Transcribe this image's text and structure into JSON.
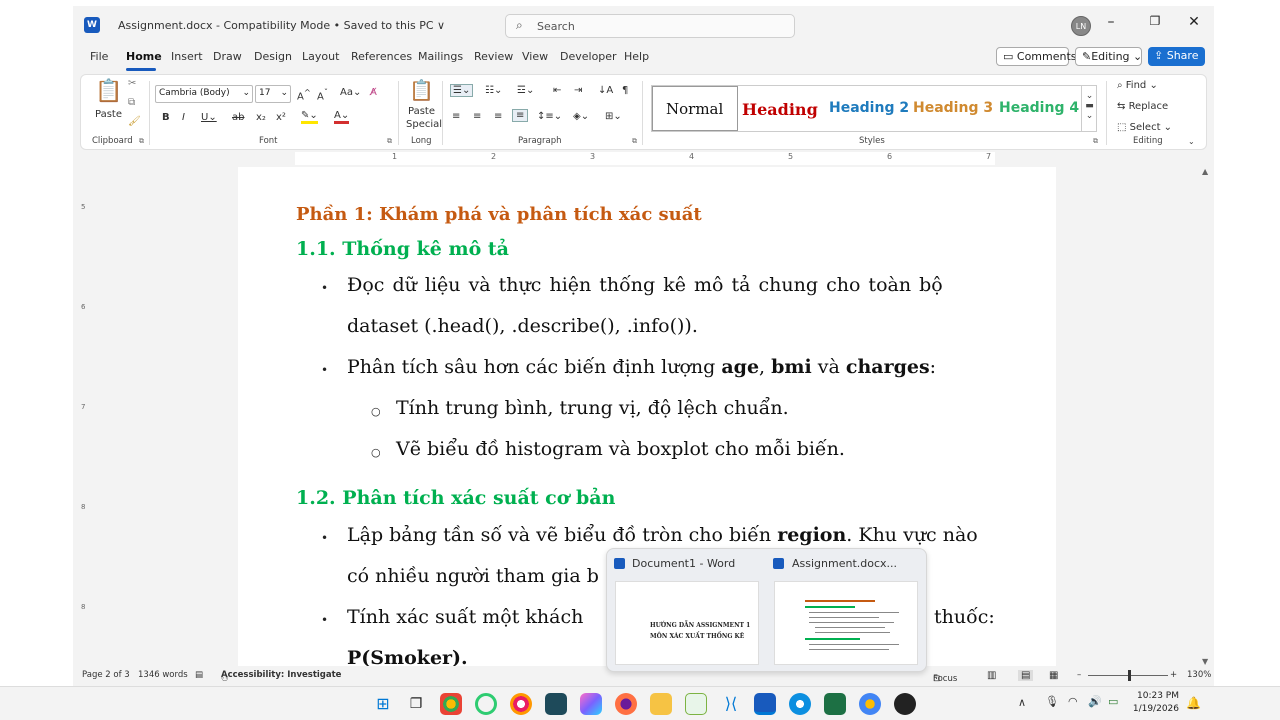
{
  "titlebar": {
    "logo": "W",
    "title": "Assignment.docx  -  Compatibility Mode  •  Saved to this PC ∨",
    "search_placeholder": "Search",
    "avatar": "LN"
  },
  "tabs": [
    "File",
    "Home",
    "Insert",
    "Draw",
    "Design",
    "Layout",
    "References",
    "Mailings",
    "Review",
    "View",
    "Developer",
    "Help"
  ],
  "top_buttons": {
    "comments": "Comments",
    "editing": "Editing",
    "share": "Share"
  },
  "ribbon": {
    "clipboard": {
      "paste": "Paste",
      "label": "Clipboard"
    },
    "font": {
      "name": "Cambria (Body)",
      "size": "17",
      "label": "Font"
    },
    "long": {
      "paste_special_1": "Paste",
      "paste_special_2": "Special",
      "label": "Long"
    },
    "paragraph": {
      "label": "Paragraph"
    },
    "styles": {
      "normal": "Normal",
      "heading": "Heading",
      "heading2": "Heading 2",
      "heading3": "Heading 3",
      "heading4": "Heading 4",
      "label": "Styles"
    },
    "editing": {
      "find": "Find",
      "replace": "Replace",
      "select": "Select",
      "label": "Editing"
    }
  },
  "ruler": [
    "1",
    "2",
    "3",
    "4",
    "5",
    "6",
    "7"
  ],
  "document": {
    "part1": "Phần 1: Khám phá và phân tích xác suất",
    "sec11": "1.1. Thống kê mô tả",
    "b1_line1": "Đọc  dữ  liệu  và  thực  hiện  thống  kê  mô  tả  chung  cho  toàn  bộ",
    "b1_line2": "dataset (.head(), .describe(), .info()).",
    "b2_pre": "Phân tích sâu hơn các biến định lượng ",
    "b2_age": "age",
    "b2_comma": ", ",
    "b2_bmi": "bmi",
    "b2_and": " và ",
    "b2_charges": "charges",
    "b2_colon": ":",
    "sub1": "Tính trung bình, trung vị, độ lệch chuẩn.",
    "sub2": "Vẽ biểu đồ histogram và boxplot cho mỗi biến.",
    "sec12": "1.2. Phân tích xác suất cơ bản",
    "b3_pre": "Lập bảng tần số và vẽ biểu đồ tròn cho biến ",
    "b3_region": "region",
    "b3_post": ". Khu vực nào",
    "b3_line2": "có nhiều người tham gia b",
    "b4_pre": "Tính xác suất một khách",
    "b4_post": "thuốc:",
    "b4_line2": "P(Smoker)."
  },
  "status": {
    "page": "Page 2 of 3",
    "words": "1346 words",
    "accessibility": "Accessibility: Investigate",
    "focus": "Focus",
    "zoom": "130%"
  },
  "preview": {
    "doc1": "Document1 - Word",
    "doc2": "Assignment.docx...",
    "thumb1_line1": "HƯỚNG DẪN ASSIGNMENT 1",
    "thumb1_line2": "MÔN XÁC XUẤT THỐNG KÊ"
  },
  "clock": {
    "time": "10:23 PM",
    "date": "1/19/2026"
  },
  "colors": {
    "accent": "#185abd",
    "heading_orange": "#c55a11",
    "heading_green": "#00b050"
  }
}
